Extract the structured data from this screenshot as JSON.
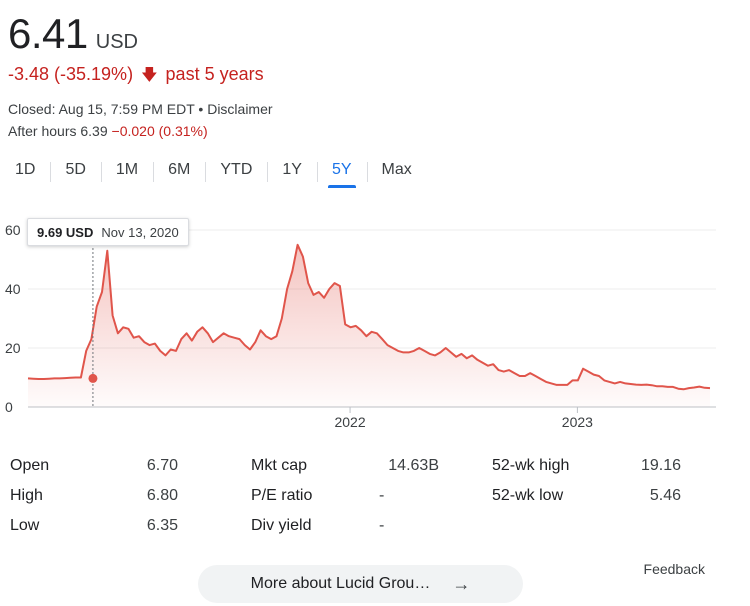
{
  "quote": {
    "price": "6.41",
    "currency": "USD",
    "change": "-3.48 (-35.19%)",
    "change_arrow": "arrow-down-icon",
    "change_period": "past 5 years",
    "closed_text": "Closed: Aug 15, 7:59 PM EDT",
    "separator": " • ",
    "disclaimer": "Disclaimer",
    "after_hours_label": "After hours 6.39",
    "after_hours_change": "−0.020 (0.31%)"
  },
  "tabs": [
    {
      "label": "1D"
    },
    {
      "label": "5D"
    },
    {
      "label": "1M"
    },
    {
      "label": "6M"
    },
    {
      "label": "YTD"
    },
    {
      "label": "1Y"
    },
    {
      "label": "5Y",
      "active": true
    },
    {
      "label": "Max"
    }
  ],
  "tooltip": {
    "value": "9.69 USD",
    "date": "Nov 13, 2020"
  },
  "colors": {
    "line": "#e0554b",
    "negative": "#c5221f",
    "active_tab": "#1a73e8"
  },
  "chart_data": {
    "type": "area",
    "x_range": [
      "2020-08",
      "2023-08"
    ],
    "ylim": [
      0,
      60
    ],
    "y_ticks": [
      "0",
      "20",
      "40",
      "60"
    ],
    "x_ticks": [
      "2022",
      "2023"
    ],
    "grid": true,
    "highlight": {
      "x": "2020-11-13",
      "y": 9.69
    },
    "series": [
      {
        "values": [
          9.7,
          9.6,
          9.5,
          9.5,
          9.6,
          9.69,
          9.7,
          9.8,
          9.9,
          10,
          10,
          19,
          23,
          34,
          39,
          53,
          31,
          25,
          27,
          26.5,
          23.5,
          24,
          22,
          21,
          21.5,
          19,
          17.5,
          19.5,
          19,
          23,
          25,
          22.5,
          25.5,
          27,
          25,
          22,
          23.5,
          25,
          24,
          23.5,
          23,
          21,
          19.5,
          22,
          26,
          24,
          23,
          24,
          30,
          40,
          46,
          55,
          51,
          42,
          38,
          39,
          37,
          40,
          42,
          41,
          28,
          27,
          27.5,
          26,
          24,
          25.5,
          25,
          23,
          21,
          20,
          19,
          18.5,
          18.5,
          19,
          20,
          19,
          18,
          17.5,
          18.5,
          20,
          18.5,
          17,
          18,
          16.5,
          17.5,
          16,
          15,
          14,
          14.5,
          12.5,
          12,
          12.5,
          11.5,
          10.5,
          10.5,
          11.5,
          10.5,
          9.5,
          8.5,
          8,
          7.5,
          7.5,
          7.5,
          9,
          9,
          13,
          12,
          11,
          10.5,
          9,
          8.5,
          8,
          8.5,
          8,
          7.8,
          7.6,
          7.5,
          7.6,
          7.4,
          7,
          7,
          6.8,
          6.8,
          6.2,
          6,
          6.4,
          6.6,
          6.9,
          6.5,
          6.41
        ]
      }
    ]
  },
  "stats": {
    "col1": [
      {
        "label": "Open",
        "value": "6.70"
      },
      {
        "label": "High",
        "value": "6.80"
      },
      {
        "label": "Low",
        "value": "6.35"
      }
    ],
    "col2": [
      {
        "label": "Mkt cap",
        "value": "14.63B"
      },
      {
        "label": "P/E ratio",
        "value": "-"
      },
      {
        "label": "Div yield",
        "value": "-"
      }
    ],
    "col3": [
      {
        "label": "52-wk high",
        "value": "19.16"
      },
      {
        "label": "52-wk low",
        "value": "5.46"
      }
    ]
  },
  "feedback": "Feedback",
  "more_button": {
    "label": "More about Lucid Grou…",
    "icon": "arrow-right-icon"
  }
}
